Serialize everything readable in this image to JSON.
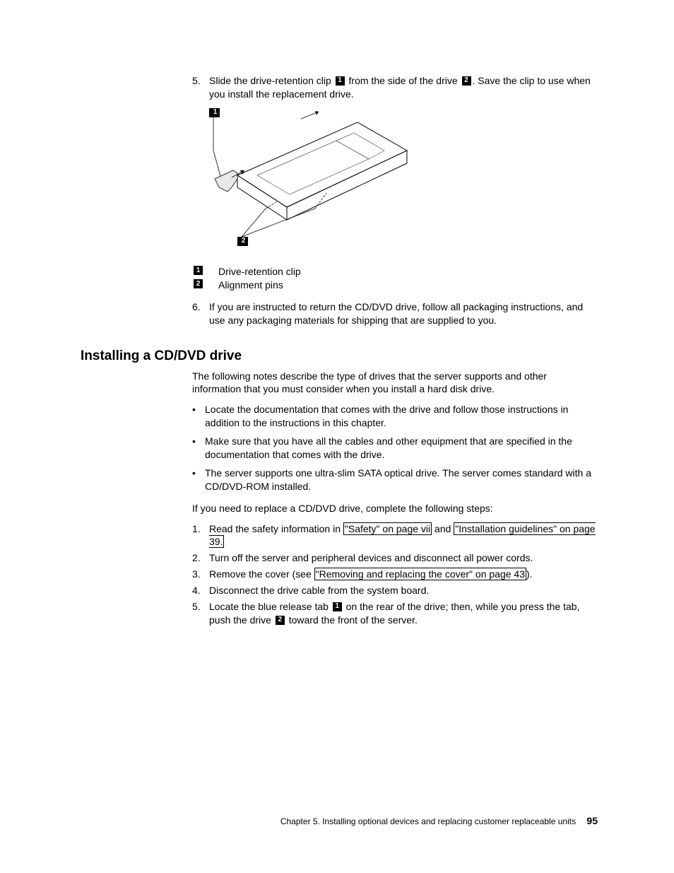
{
  "top_steps": {
    "step5": {
      "num": "5.",
      "text_a": "Slide the drive-retention clip ",
      "c1": "1",
      "text_b": " from the side of the drive ",
      "c2": "2",
      "text_c": ". Save the clip to use when you install the replacement drive."
    },
    "step6": {
      "num": "6.",
      "text": "If you are instructed to return the CD/DVD drive, follow all packaging instructions, and use any packaging materials for shipping that are supplied to you."
    }
  },
  "figure": {
    "c1": "1",
    "c2": "2"
  },
  "legend": {
    "c1": "1",
    "c2": "2",
    "label1": "Drive-retention clip",
    "label2": "Alignment pins"
  },
  "section_title": "Installing a CD/DVD drive",
  "intro": "The following notes describe the type of drives that the server supports and other information that you must consider when you install a hard disk drive.",
  "bullets": {
    "b1": "Locate the documentation that comes with the drive and follow those instructions in addition to the instructions in this chapter.",
    "b2": "Make sure that you have all the cables and other equipment that are specified in the documentation that comes with the drive.",
    "b3": "The server supports one ultra-slim SATA optical drive. The server comes standard with a CD/DVD-ROM installed."
  },
  "replace_intro": "If you need to replace a CD/DVD drive, complete the following steps:",
  "steps": {
    "s1": {
      "num": "1.",
      "text_a": "Read the safety information in ",
      "link1": "\"Safety\" on page vii",
      "text_b": " and ",
      "link2": "\"Installation guidelines\" on page 39.",
      "text_c": ""
    },
    "s2": {
      "num": "2.",
      "text": "Turn off the server and peripheral devices and disconnect all power cords."
    },
    "s3": {
      "num": "3.",
      "text_a": "Remove the cover (see ",
      "link1": "\"Removing and replacing the cover\" on page 43",
      "text_b": ")."
    },
    "s4": {
      "num": "4.",
      "text": "Disconnect the drive cable from the system board."
    },
    "s5": {
      "num": "5.",
      "text_a": "Locate the blue release tab ",
      "c1": "1",
      "text_b": " on the rear of the drive; then, while you press the tab, push the drive ",
      "c2": "2",
      "text_c": " toward the front of the server."
    }
  },
  "footer": {
    "chapter": "Chapter 5. Installing optional devices and replacing customer replaceable units",
    "page": "95"
  }
}
